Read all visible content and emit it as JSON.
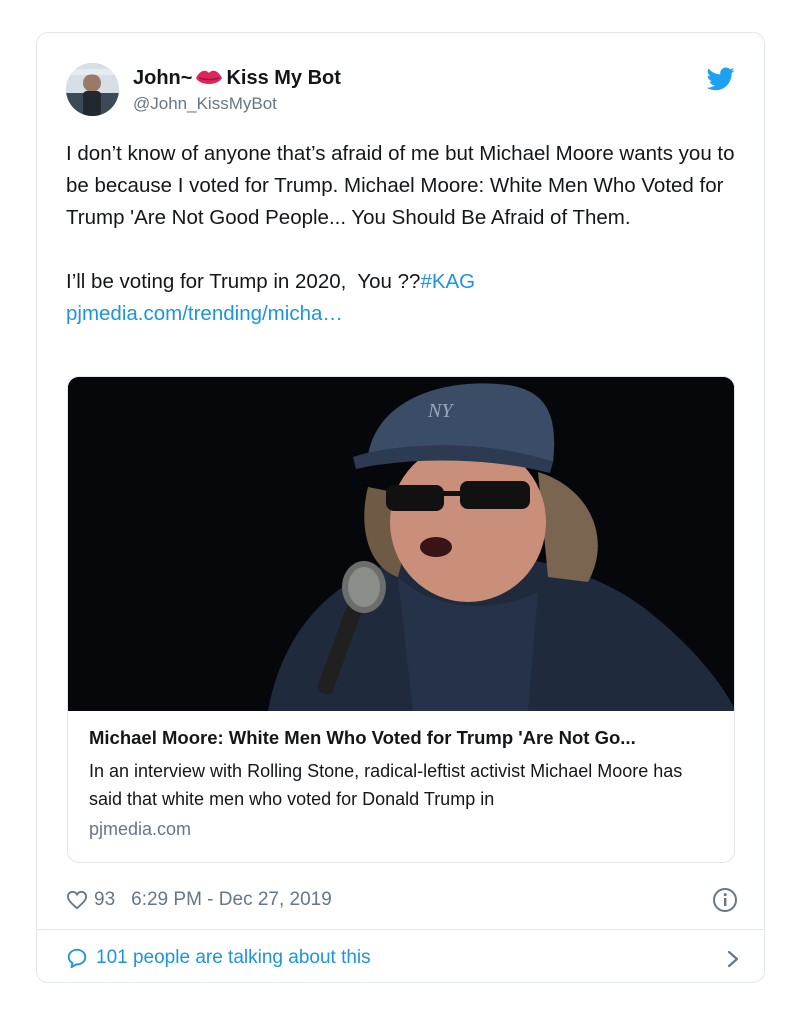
{
  "user": {
    "name_prefix": "John~",
    "name_suffix": "Kiss My Bot",
    "handle": "@John_KissMyBot"
  },
  "tweet": {
    "text_main": "I don’t know of anyone that’s afraid of me but Michael Moore wants you to be because I voted for Trump. Michael Moore: White Men Who Voted for Trump 'Are Not Good People... You Should Be Afraid of Them.\n\nI’ll be voting for Trump in 2020,  You ??",
    "hashtag": "#KAG",
    "url": "pjmedia.com/trending/micha…"
  },
  "link_card": {
    "title": "Michael Moore: White Men Who Voted for Trump 'Are Not Go...",
    "description": "In an interview with Rolling Stone, radical-leftist activist Michael Moore has said that white men who voted for Donald Trump in",
    "domain": "pjmedia.com"
  },
  "meta": {
    "likes": "93",
    "timestamp": "6:29 PM - Dec 27, 2019"
  },
  "footer": {
    "talking": "101 people are talking about this"
  },
  "colors": {
    "link": "#1b95e0",
    "secondary_text": "#657786",
    "border": "#e1e8ed",
    "lips": "#e0245e"
  },
  "icons": {
    "brand": "twitter-bird-icon",
    "emoji": "kiss-lips-icon",
    "like": "heart-icon",
    "info": "info-icon",
    "reply": "speech-bubble-icon",
    "more": "chevron-right-icon"
  }
}
